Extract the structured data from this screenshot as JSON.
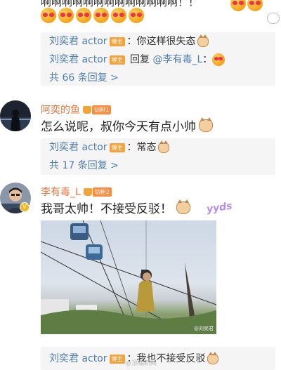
{
  "top": {
    "text": "啊啊啊啊啊啊啊啊啊啊啊啊啊！！",
    "emoji_count": 6
  },
  "thread1": {
    "replies": [
      {
        "name": "刘奕君 actor",
        "badge": "博主",
        "text": "：你这样很失态"
      },
      {
        "name": "刘奕君 actor",
        "badge": "博主",
        "text_prefix": " 回复 ",
        "mention": "@李有毒_L",
        "text": "："
      }
    ],
    "more": "共 66 条回复 >"
  },
  "comment2": {
    "username": "阿奕的鱼",
    "fan_badge": "钻粉1",
    "text": "怎么说呢，叔你今天有点小帅",
    "reply": {
      "name": "刘奕君 actor",
      "badge": "博主",
      "text": "：常态"
    },
    "more": "共 17 条回复 >"
  },
  "comment3": {
    "username": "李有毒_L",
    "fan_badge": "钻粉2",
    "verified": "V",
    "text": "我哥太帅！不接受反驳！",
    "sticker_text": "yyds",
    "photo_watermark": "@刘奕君",
    "reply": {
      "name": "刘奕君 actor",
      "badge": "博主",
      "text": "：我也不接受反驳"
    }
  },
  "footer": {
    "watermark": "@顶端新闻"
  },
  "colors": {
    "link": "#507daf",
    "username": "#e8743b",
    "host_badge": "#f4a33c",
    "reply_bg": "#f5f5f5"
  }
}
